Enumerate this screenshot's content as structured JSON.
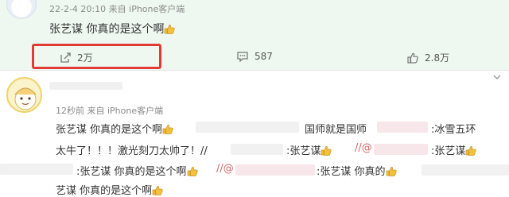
{
  "post": {
    "timestamp": "22-2-4 20:10",
    "source": "来自 iPhone客户端",
    "text": "张艺谋 你真的是这个啊"
  },
  "actions": {
    "share_count": "2万",
    "comment_count": "587",
    "like_count": "2.8万"
  },
  "comment": {
    "time": "12秒前",
    "source": "来自 iPhone客户端",
    "lines": {
      "l1_a": "张艺谋 你真的是这个啊",
      "l1_b": "国师就是国师",
      "l1_c": ":冰雪五环",
      "l2_a": "太牛了！！！激光刻刀太帅了！//",
      "l2_b": ":张艺谋",
      "l2_c": "//@",
      "l2_d": ":张艺谋",
      "l3_a": ":张艺谋 你真的是这个啊",
      "l3_b": "//@",
      "l3_c": ":张艺谋 你真的",
      "l4_a": "艺谋 你真的是这个啊"
    }
  },
  "colors": {
    "post_bg": "#eef8f0",
    "highlight": "#e23b35",
    "emoji_yellow": "#f3c13a"
  }
}
